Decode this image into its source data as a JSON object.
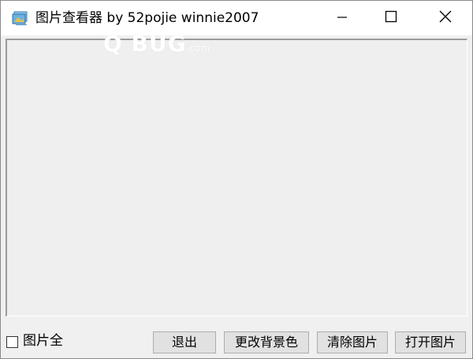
{
  "window": {
    "title": "图片查看器  by 52pojie winnie2007",
    "icons": {
      "app": "image-viewer-app-icon",
      "minimize": "minimize-icon",
      "maximize": "maximize-icon",
      "close": "close-icon"
    }
  },
  "watermark": {
    "main": "Q BUG",
    "small": ".com"
  },
  "options": {
    "fit_checkbox_label": "图片全",
    "fit_checked": false
  },
  "buttons": {
    "exit": "退出",
    "change_background": "更改背景色",
    "clear_image": "清除图片",
    "open_image": "打开图片"
  },
  "colors": {
    "background": "#f0f0f0",
    "titlebar": "#ffffff",
    "button": "#e1e1e1"
  }
}
